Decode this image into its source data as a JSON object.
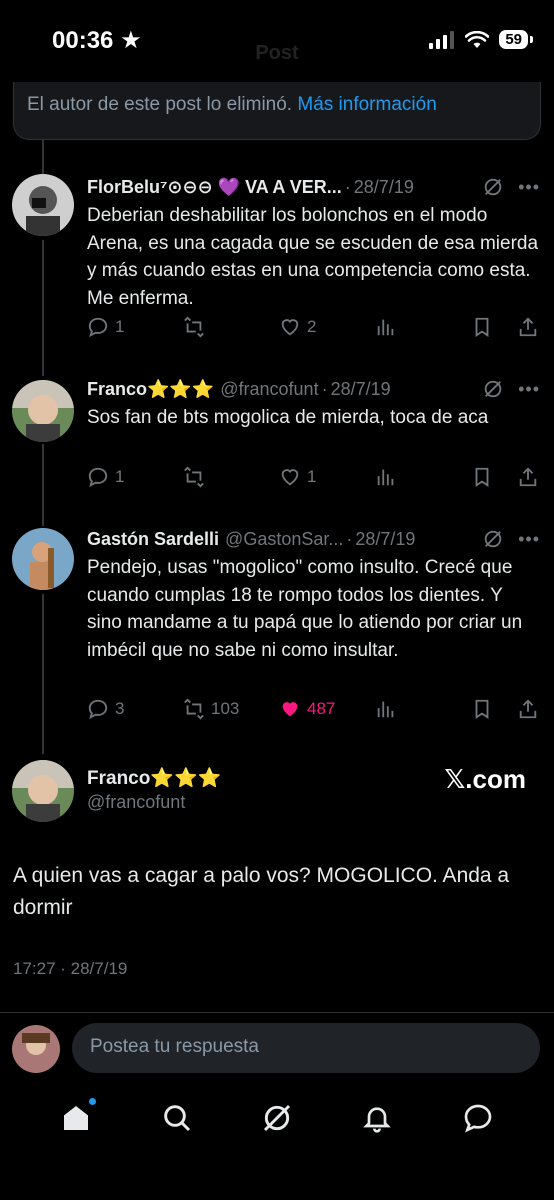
{
  "status_bar": {
    "time": "00:36",
    "battery": "59"
  },
  "header": {
    "title": "Post"
  },
  "deleted_notice": {
    "text": "El autor de este post lo eliminó.",
    "link": "Más información"
  },
  "replies": [
    {
      "name": "FlorBelu⁷⊙⊖⊖ 💜 VA A VER...",
      "handle": "",
      "date": "28/7/19",
      "text": "Deberian deshabilitar los bolonchos en el modo Arena, es una cagada que se escuden de esa mierda y más cuando estas en una competencia como esta. Me enferma.",
      "replies": "1",
      "reposts": "",
      "likes": "2"
    },
    {
      "name": "Franco⭐⭐⭐",
      "handle": "@francofunt",
      "date": "28/7/19",
      "text": "Sos fan de bts mogolica de mierda, toca de aca",
      "replies": "1",
      "reposts": "",
      "likes": "1"
    },
    {
      "name": "Gastón Sardelli",
      "handle": "@GastonSar...",
      "date": "28/7/19",
      "text": "Pendejo, usas \"mogolico\" como insulto. Crecé que cuando cumplas 18 te rompo todos los dientes. Y sino mandame a tu papá que lo atiendo por criar un imbécil que no sabe ni como insultar.",
      "replies": "3",
      "reposts": "103",
      "likes": "487"
    }
  ],
  "main_tweet": {
    "name": "Franco⭐⭐⭐",
    "handle": "@francofunt",
    "watermark": "𝕏.com",
    "text": "A quien vas a cagar a palo vos? MOGOLICO. Anda a dormir",
    "timestamp": "17:27 · 28/7/19"
  },
  "reply_bar": {
    "placeholder": "Postea tu respuesta"
  },
  "colors": {
    "accent": "#1d9bf0",
    "like": "#f91880",
    "muted": "#71767b"
  },
  "tabs": [
    "home-icon",
    "search-icon",
    "grok-icon",
    "notifications-icon",
    "messages-icon"
  ]
}
